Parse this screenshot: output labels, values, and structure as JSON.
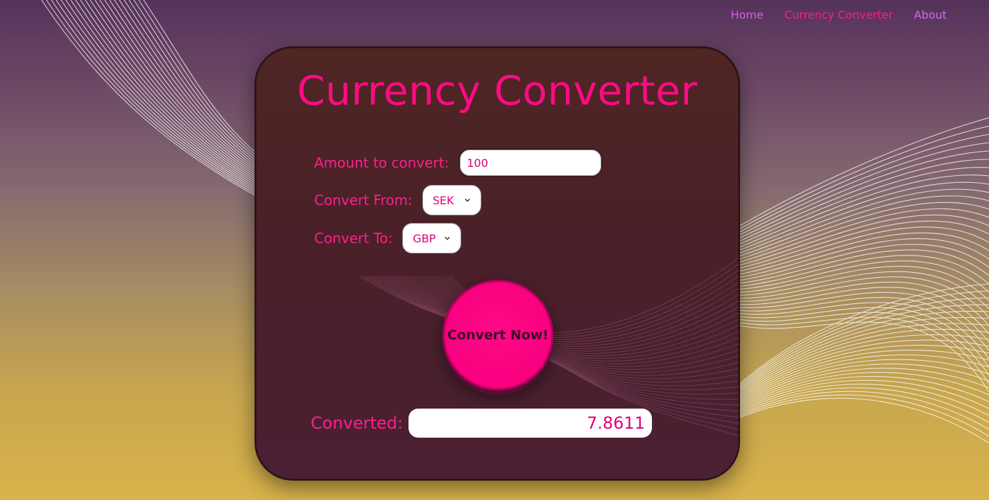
{
  "nav": {
    "items": [
      {
        "label": "Home"
      },
      {
        "label": "Currency Converter"
      },
      {
        "label": "About"
      }
    ]
  },
  "converter": {
    "title": "Currency Converter",
    "amount_label": "Amount to convert:",
    "amount_value": "100",
    "from_label": "Convert From:",
    "from_value": "SEK",
    "to_label": "Convert To:",
    "to_value": "GBP",
    "button_label": "Convert Now!",
    "result_label": "Converted:",
    "result_value": "7.8611"
  },
  "colors": {
    "accent": "#ff0a84",
    "nav_link": "#d958ef",
    "card_bg": "#4a2029"
  },
  "icons": {
    "select_arrow": "chevron-down-icon"
  }
}
